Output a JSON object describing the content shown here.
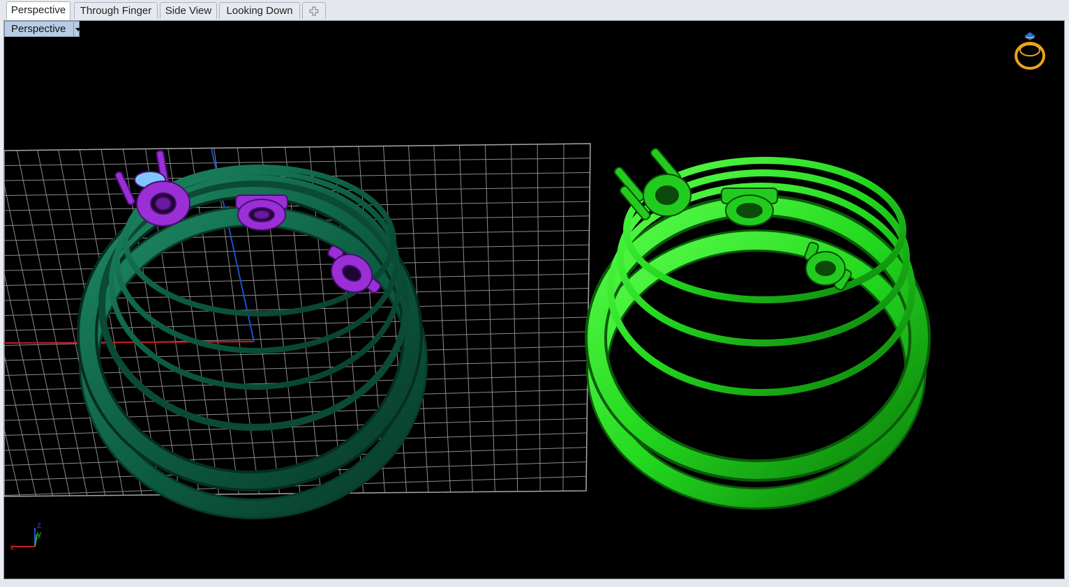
{
  "tabs": [
    {
      "label": "Perspective",
      "active": true
    },
    {
      "label": "Through Finger",
      "active": false
    },
    {
      "label": "Side View",
      "active": false
    },
    {
      "label": "Looking Down",
      "active": false
    }
  ],
  "add_tab_icon": "plus-icon",
  "viewport": {
    "label": "Perspective",
    "dropdown_icon": "chevron-down-icon",
    "background": "#000000",
    "corner_icon": "ring-icon",
    "axis_labels": {
      "x": "x",
      "y": "y",
      "z": "z"
    }
  },
  "objects": {
    "left_ring_color": "#0f6a4a",
    "left_settings_color": "#9b2fd6",
    "right_ring_color": "#22dd22",
    "grid_color": "#8c8c8c"
  }
}
